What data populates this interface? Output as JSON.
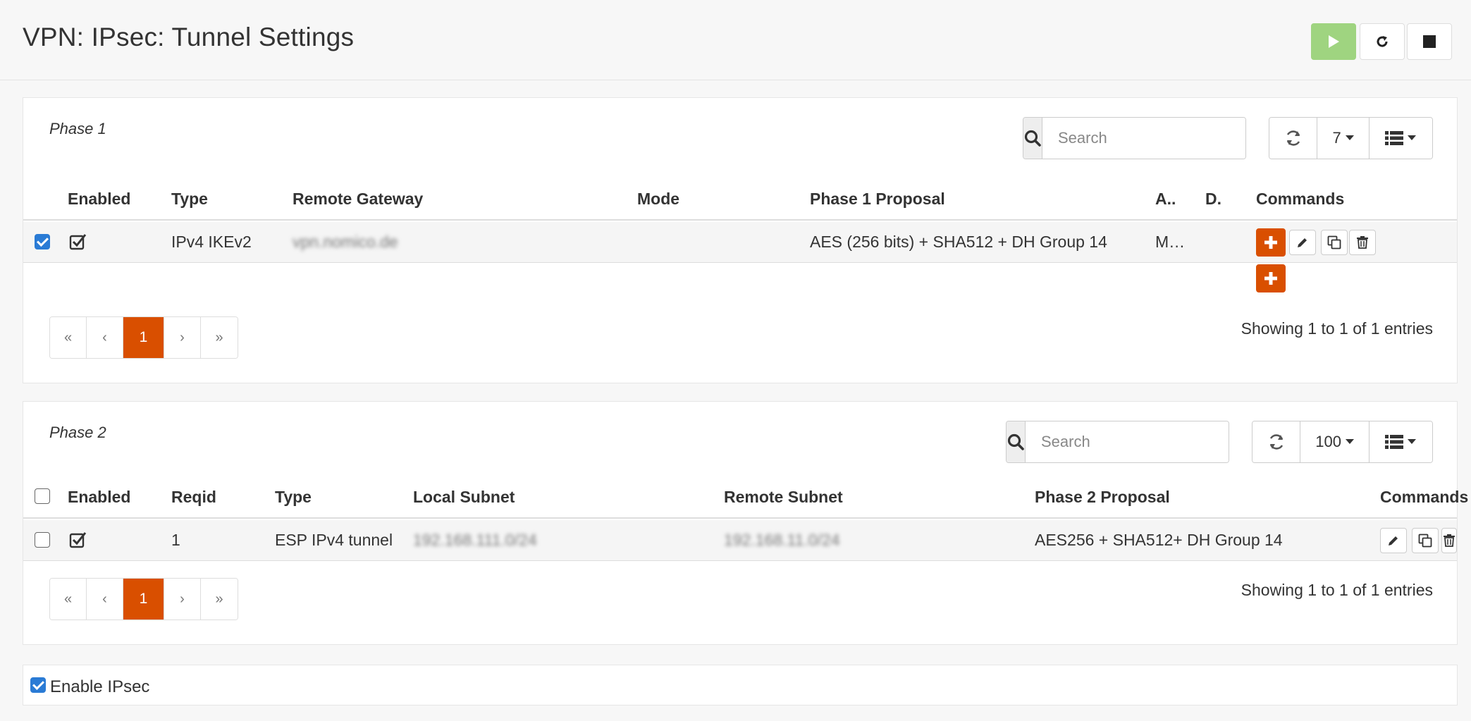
{
  "header": {
    "title": "VPN: IPsec: Tunnel Settings",
    "buttons": {
      "start": "play-icon",
      "restart": "restart-icon",
      "stop": "stop-icon"
    }
  },
  "phase1": {
    "title": "Phase 1",
    "search_placeholder": "Search",
    "page_size": "7",
    "columns": [
      "Enabled",
      "Type",
      "Remote Gateway",
      "Mode",
      "Phase 1 Proposal",
      "A..",
      "D.",
      "Commands"
    ],
    "rows": [
      {
        "selected": true,
        "enabled": true,
        "type": "IPv4 IKEv2",
        "remote_gateway": "vpn.nomico.de",
        "mode": "",
        "proposal": "AES (256 bits) + SHA512 + DH Group 14",
        "a": "M…",
        "d": ""
      }
    ],
    "pagination": {
      "first": "«",
      "prev": "‹",
      "current": "1",
      "next": "›",
      "last": "»"
    },
    "info": "Showing 1 to 1 of 1 entries"
  },
  "phase2": {
    "title": "Phase 2",
    "search_placeholder": "Search",
    "page_size": "100",
    "columns": [
      "Enabled",
      "Reqid",
      "Type",
      "Local Subnet",
      "Remote Subnet",
      "Phase 2 Proposal",
      "Commands"
    ],
    "rows": [
      {
        "selected": false,
        "enabled": true,
        "reqid": "1",
        "type": "ESP IPv4 tunnel",
        "local_subnet": "192.168.111.0/24",
        "remote_subnet": "192.168.11.0/24",
        "proposal": "AES256 + SHA512+ DH Group 14"
      }
    ],
    "pagination": {
      "first": "«",
      "prev": "‹",
      "current": "1",
      "next": "›",
      "last": "»"
    },
    "info": "Showing 1 to 1 of 1 entries"
  },
  "enable_ipsec": {
    "label": "Enable IPsec",
    "checked": true
  },
  "colors": {
    "accent": "#d94f00",
    "start_green": "#9fd480",
    "checkbox_blue": "#2a7bd5"
  }
}
